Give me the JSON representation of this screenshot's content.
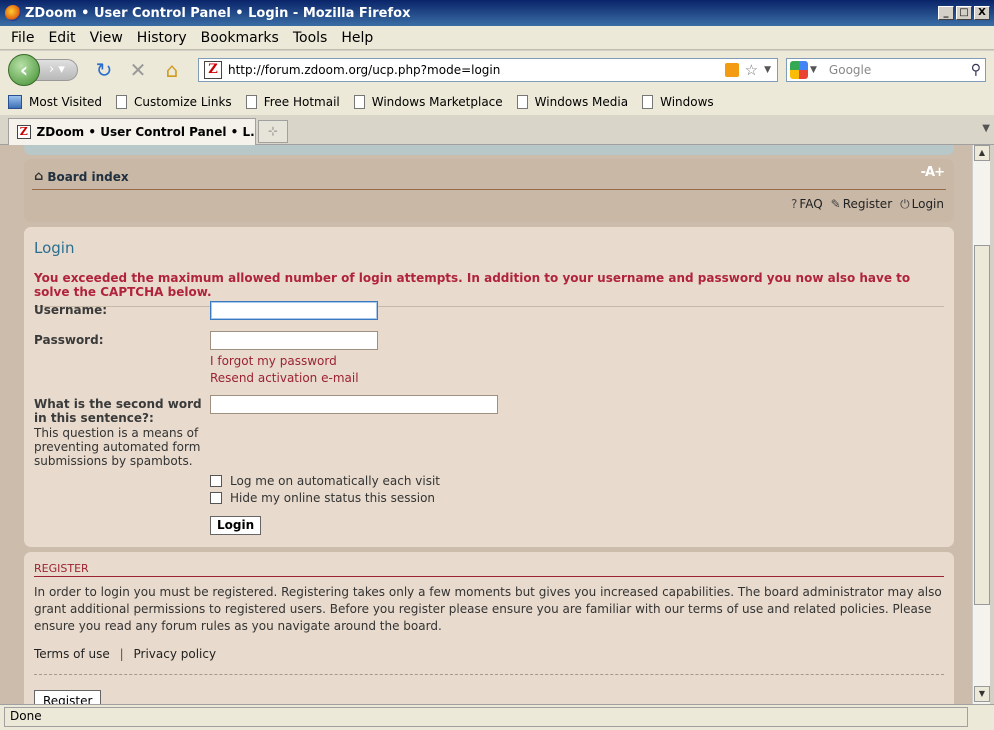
{
  "window": {
    "title": "ZDoom • User Control Panel • Login - Mozilla Firefox",
    "minimize": "_",
    "maximize": "□",
    "close": "X"
  },
  "menu": [
    "File",
    "Edit",
    "View",
    "History",
    "Bookmarks",
    "Tools",
    "Help"
  ],
  "nav": {
    "url": "http://forum.zdoom.org/ucp.php?mode=login",
    "search_placeholder": "Google"
  },
  "bookmarks": [
    "Most Visited",
    "Customize Links",
    "Free Hotmail",
    "Windows Marketplace",
    "Windows Media",
    "Windows"
  ],
  "tab": {
    "label": "ZDoom • User Control Panel • L..."
  },
  "header": {
    "board_index": "Board index",
    "faq": "FAQ",
    "register": "Register",
    "login": "Login",
    "font_size": "-A+"
  },
  "login": {
    "title": "Login",
    "error": "You exceeded the maximum allowed number of login attempts. In addition to your username and password you now also have to solve the CAPTCHA below.",
    "username_label": "Username:",
    "password_label": "Password:",
    "forgot": "I forgot my password",
    "resend": "Resend activation e-mail",
    "question_label": "What is the second word in this sentence?:",
    "question_desc": "This question is a means of preventing automated form submissions by spambots.",
    "auto_login": "Log me on automatically each visit",
    "hide_status": "Hide my online status this session",
    "button": "Login"
  },
  "register": {
    "title": "REGISTER",
    "text": "In order to login you must be registered. Registering takes only a few moments but gives you increased capabilities. The board administrator may also grant additional permissions to registered users. Before you register please ensure you are familiar with our terms of use and related policies. Please ensure you read any forum rules as you navigate around the board.",
    "terms": "Terms of use",
    "privacy": "Privacy policy",
    "separator": "|",
    "button": "Register"
  },
  "status": {
    "text": "Done"
  }
}
